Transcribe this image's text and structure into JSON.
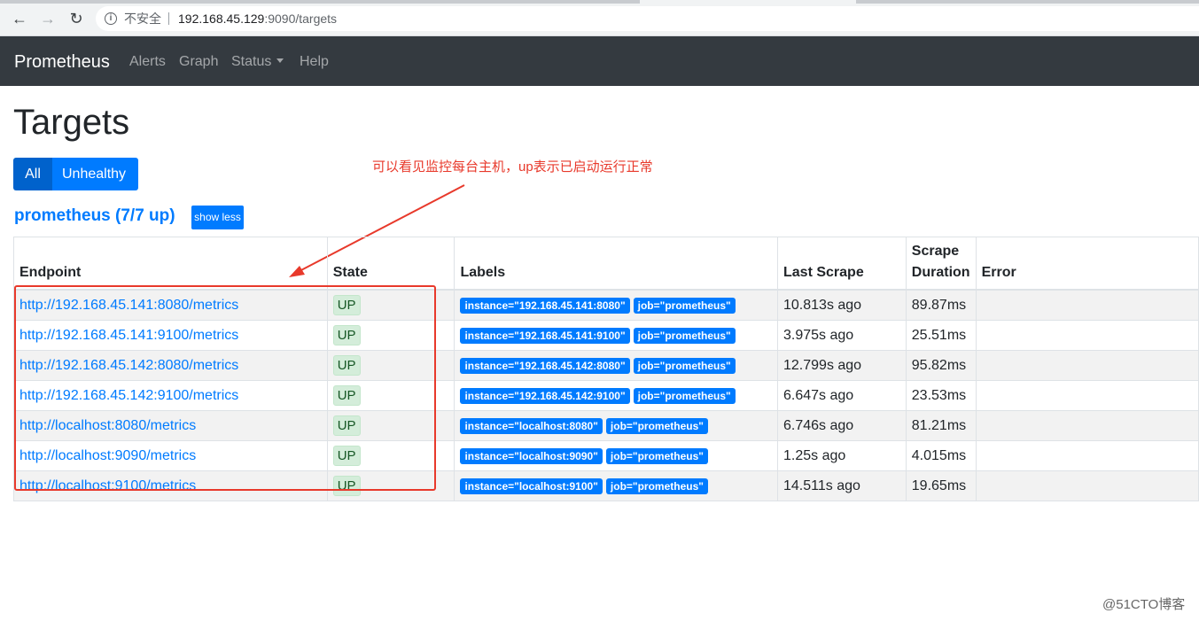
{
  "browser": {
    "nav_back_icon": "←",
    "nav_forward_icon": "→",
    "reload_icon": "↻",
    "info_icon": "i",
    "security_label": "不安全",
    "url_host": "192.168.45.129",
    "url_rest": ":9090/targets"
  },
  "navbar": {
    "brand": "Prometheus",
    "links": [
      "Alerts",
      "Graph",
      "Status",
      "Help"
    ]
  },
  "page": {
    "title": "Targets",
    "filter_all": "All",
    "filter_unhealthy": "Unhealthy",
    "annotation": "可以看见监控每台主机，up表示已启动运行正常"
  },
  "job": {
    "header": "prometheus (7/7 up)",
    "toggle_label": "show less"
  },
  "table": {
    "headers": {
      "endpoint": "Endpoint",
      "state": "State",
      "labels": "Labels",
      "last_scrape": "Last Scrape",
      "scrape_duration_line1": "Scrape",
      "scrape_duration_line2": "Duration",
      "error": "Error"
    },
    "rows": [
      {
        "endpoint": "http://192.168.45.141:8080/metrics",
        "state": "UP",
        "instance": "instance=\"192.168.45.141:8080\"",
        "job": "job=\"prometheus\"",
        "last_scrape": "10.813s ago",
        "duration": "89.87ms",
        "error": ""
      },
      {
        "endpoint": "http://192.168.45.141:9100/metrics",
        "state": "UP",
        "instance": "instance=\"192.168.45.141:9100\"",
        "job": "job=\"prometheus\"",
        "last_scrape": "3.975s ago",
        "duration": "25.51ms",
        "error": ""
      },
      {
        "endpoint": "http://192.168.45.142:8080/metrics",
        "state": "UP",
        "instance": "instance=\"192.168.45.142:8080\"",
        "job": "job=\"prometheus\"",
        "last_scrape": "12.799s ago",
        "duration": "95.82ms",
        "error": ""
      },
      {
        "endpoint": "http://192.168.45.142:9100/metrics",
        "state": "UP",
        "instance": "instance=\"192.168.45.142:9100\"",
        "job": "job=\"prometheus\"",
        "last_scrape": "6.647s ago",
        "duration": "23.53ms",
        "error": ""
      },
      {
        "endpoint": "http://localhost:8080/metrics",
        "state": "UP",
        "instance": "instance=\"localhost:8080\"",
        "job": "job=\"prometheus\"",
        "last_scrape": "6.746s ago",
        "duration": "81.21ms",
        "error": ""
      },
      {
        "endpoint": "http://localhost:9090/metrics",
        "state": "UP",
        "instance": "instance=\"localhost:9090\"",
        "job": "job=\"prometheus\"",
        "last_scrape": "1.25s ago",
        "duration": "4.015ms",
        "error": ""
      },
      {
        "endpoint": "http://localhost:9100/metrics",
        "state": "UP",
        "instance": "instance=\"localhost:9100\"",
        "job": "job=\"prometheus\"",
        "last_scrape": "14.511s ago",
        "duration": "19.65ms",
        "error": ""
      }
    ]
  },
  "watermark": "@51CTO博客",
  "colors": {
    "navbar_bg": "#343a40",
    "primary": "#007bff",
    "annotation_red": "#e8392b",
    "up_badge_bg": "#d4edda"
  }
}
